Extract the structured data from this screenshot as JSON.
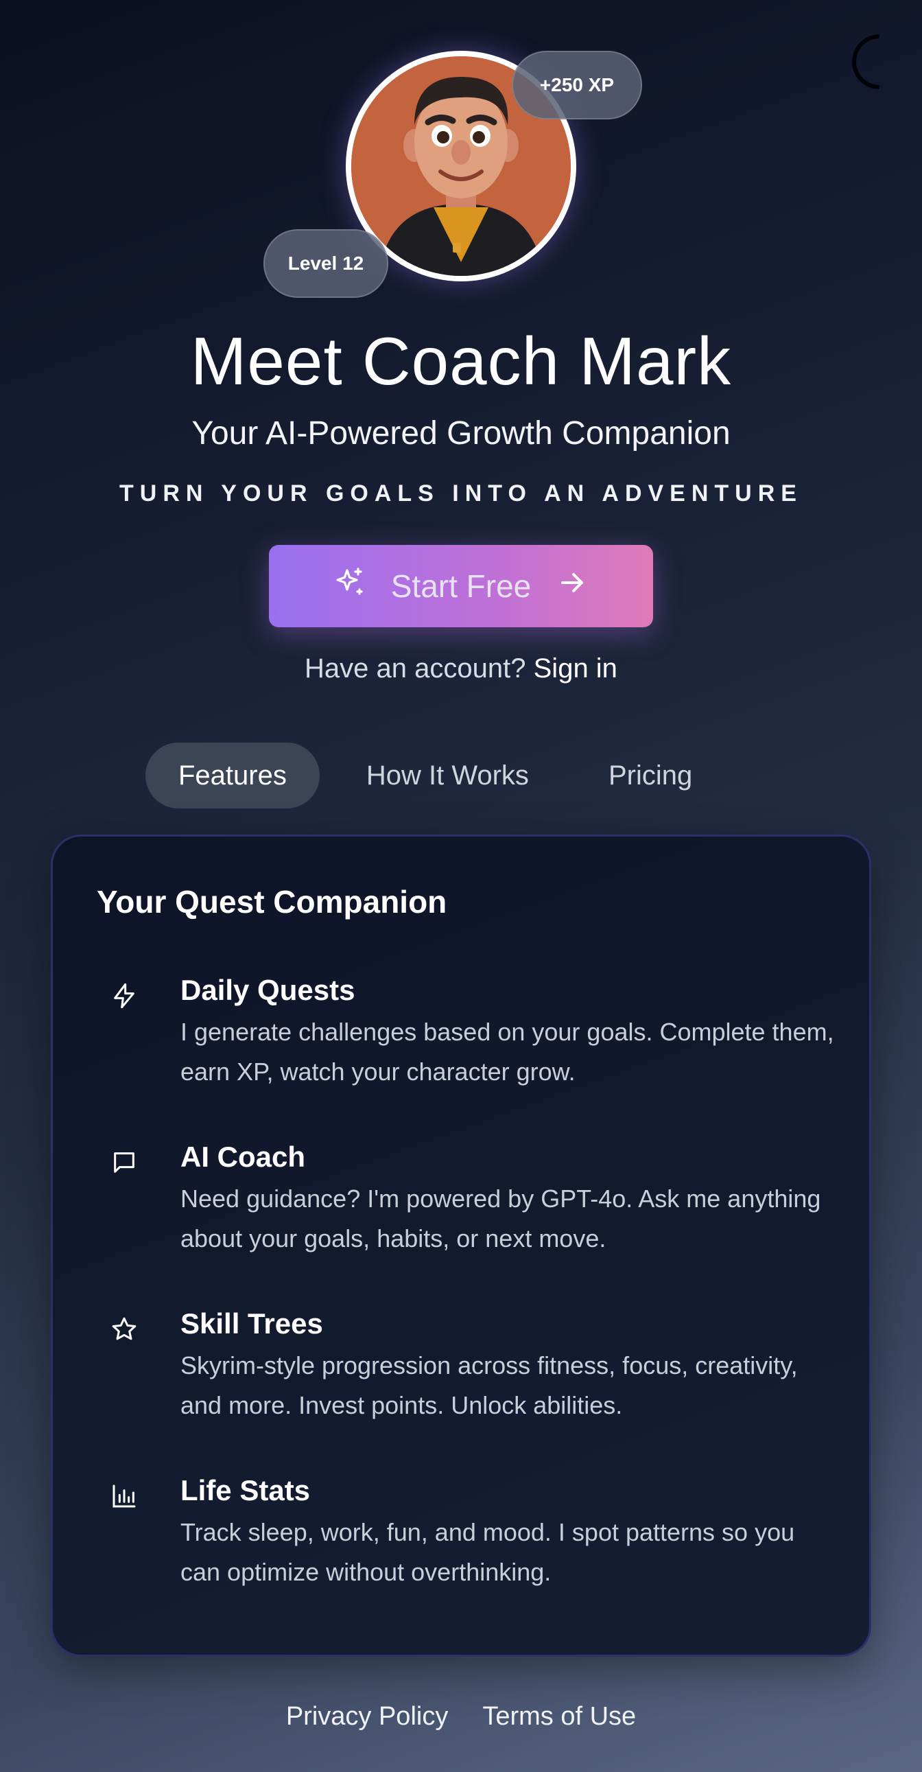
{
  "hero": {
    "xp_badge": "+250 XP",
    "level_badge": "Level 12",
    "title": "Meet Coach Mark",
    "subtitle": "Your AI-Powered Growth Companion",
    "tagline": "TURN YOUR GOALS INTO AN ADVENTURE",
    "cta_label": "Start Free",
    "cta_icons": {
      "leading": "sparkles-icon",
      "trailing": "arrow-right-icon"
    },
    "signin_prompt": "Have an account?",
    "signin_link": "Sign in"
  },
  "tabs": [
    {
      "label": "Features",
      "active": true
    },
    {
      "label": "How It Works",
      "active": false
    },
    {
      "label": "Pricing",
      "active": false
    }
  ],
  "card": {
    "title": "Your Quest Companion",
    "features": [
      {
        "icon": "lightning-icon",
        "name": "Daily Quests",
        "description": "I generate challenges based on your goals. Complete them, earn XP, watch your character grow."
      },
      {
        "icon": "chat-bubble-icon",
        "name": "AI Coach",
        "description": "Need guidance? I'm powered by GPT-4o. Ask me anything about your goals, habits, or next move."
      },
      {
        "icon": "star-icon",
        "name": "Skill Trees",
        "description": "Skyrim-style progression across fitness, focus, creativity, and more. Invest points. Unlock abilities."
      },
      {
        "icon": "bar-chart-icon",
        "name": "Life Stats",
        "description": "Track sleep, work, fun, and mood. I spot patterns so you can optimize without overthinking."
      }
    ]
  },
  "footer": {
    "privacy": "Privacy Policy",
    "terms": "Terms of Use"
  },
  "colors": {
    "cta_gradient_start": "#9a70f0",
    "cta_gradient_end": "#e07ab8",
    "card_border": "#2e2f66",
    "active_tab_bg": "#3c4556"
  }
}
